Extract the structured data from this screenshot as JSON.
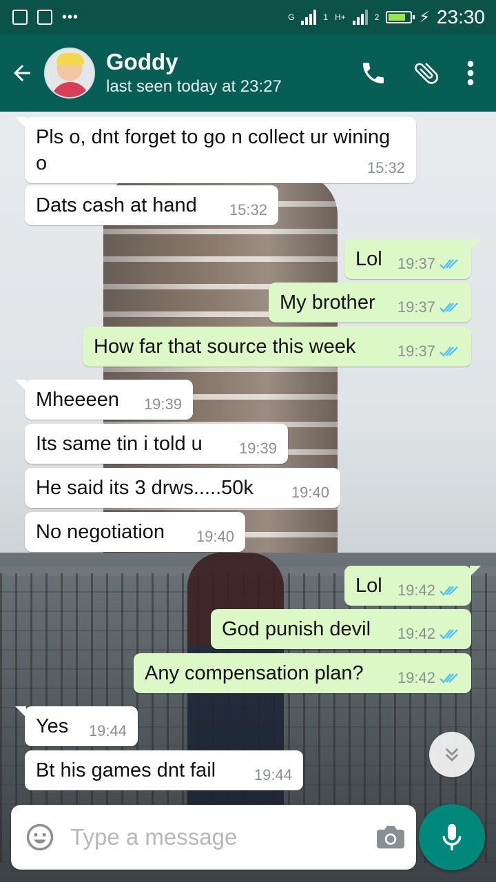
{
  "status_bar": {
    "time": "23:30",
    "sim1_label": "1",
    "sim2_label": "2",
    "net1_label": "G",
    "net2_label": "H+"
  },
  "header": {
    "contact_name": "Goddy",
    "contact_status": "last seen today at 23:27"
  },
  "messages": [
    {
      "dir": "in",
      "text": "Pls o, dnt forget to go n collect ur wining o",
      "time": "15:32"
    },
    {
      "dir": "in",
      "text": "Dats cash at hand",
      "time": "15:32"
    },
    {
      "dir": "out",
      "text": "Lol",
      "time": "19:37",
      "read": true
    },
    {
      "dir": "out",
      "text": "My brother",
      "time": "19:37",
      "read": true
    },
    {
      "dir": "out",
      "text": "How far that source this week",
      "time": "19:37",
      "read": true
    },
    {
      "dir": "in",
      "text": "Mheeeen",
      "time": "19:39"
    },
    {
      "dir": "in",
      "text": "Its same tin i told u",
      "time": "19:39"
    },
    {
      "dir": "in",
      "text": "He said its 3 drws.....50k",
      "time": "19:40"
    },
    {
      "dir": "in",
      "text": "No negotiation",
      "time": "19:40"
    },
    {
      "dir": "out",
      "text": "Lol",
      "time": "19:42",
      "read": true
    },
    {
      "dir": "out",
      "text": "God punish devil",
      "time": "19:42",
      "read": true
    },
    {
      "dir": "out",
      "text": "Any compensation plan?",
      "time": "19:42",
      "read": true
    },
    {
      "dir": "in",
      "text": "Yes",
      "time": "19:44"
    },
    {
      "dir": "in",
      "text": "Bt his games dnt fail",
      "time": "19:44"
    }
  ],
  "composer": {
    "placeholder": "Type a message",
    "value": ""
  },
  "icons": {
    "back": "arrow-back-icon",
    "call": "phone-icon",
    "attach": "paperclip-icon",
    "menu": "more-vert-icon",
    "emoji": "emoji-icon",
    "camera": "camera-icon",
    "mic": "mic-icon",
    "scroll": "double-chevron-down-icon"
  },
  "colors": {
    "header": "#075e54",
    "status_bar": "#0b5249",
    "incoming_bubble": "#ffffff",
    "outgoing_bubble": "#dcf8c6",
    "read_tick": "#4fc3f7",
    "mic_button": "#00897b"
  }
}
